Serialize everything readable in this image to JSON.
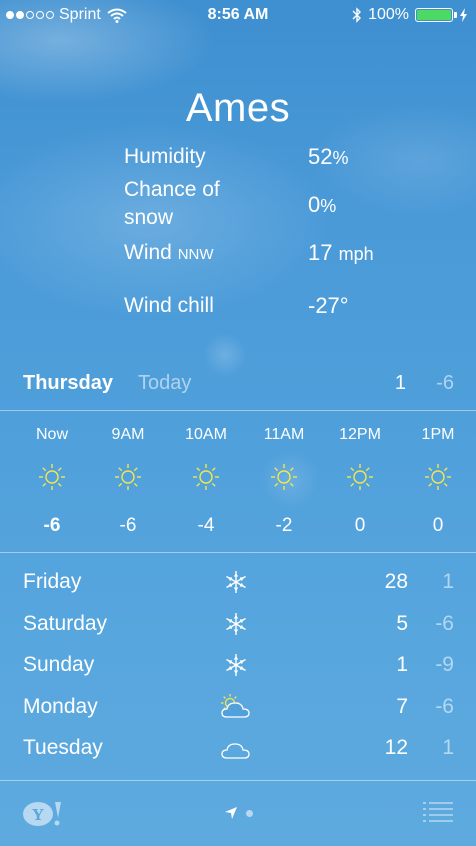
{
  "status": {
    "carrier": "Sprint",
    "time": "8:56 AM",
    "battery": "100%",
    "signal_bars": 2,
    "signal_total": 5
  },
  "city": "Ames",
  "details": {
    "humidity_label": "Humidity",
    "humidity_value": "52",
    "humidity_unit": "%",
    "snow_label_line1": "Chance of",
    "snow_label_line2": "snow",
    "snow_value": "0",
    "snow_unit": "%",
    "wind_label": "Wind",
    "wind_dir": "NNW",
    "wind_value": "17",
    "wind_unit": "mph",
    "chill_label": "Wind chill",
    "chill_value": "-27°"
  },
  "today": {
    "day": "Thursday",
    "label": "Today",
    "high": "1",
    "low": "-6"
  },
  "hourly": [
    {
      "label": "Now",
      "temp": "-6",
      "icon": "sun-icon"
    },
    {
      "label": "9AM",
      "temp": "-6",
      "icon": "sun-icon"
    },
    {
      "label": "10AM",
      "temp": "-4",
      "icon": "sun-icon"
    },
    {
      "label": "11AM",
      "temp": "-2",
      "icon": "sun-icon"
    },
    {
      "label": "12PM",
      "temp": "0",
      "icon": "sun-icon"
    },
    {
      "label": "1PM",
      "temp": "0",
      "icon": "sun-icon"
    }
  ],
  "daily": [
    {
      "day": "Friday",
      "icon": "snowflake-icon",
      "high": "28",
      "low": "1"
    },
    {
      "day": "Saturday",
      "icon": "snowflake-icon",
      "high": "5",
      "low": "-6"
    },
    {
      "day": "Sunday",
      "icon": "snowflake-icon",
      "high": "1",
      "low": "-9"
    },
    {
      "day": "Monday",
      "icon": "partly-cloudy-icon",
      "high": "7",
      "low": "-6"
    },
    {
      "day": "Tuesday",
      "icon": "cloud-icon",
      "high": "12",
      "low": "1"
    }
  ],
  "colors": {
    "sun": "#f7e64a",
    "battery": "#4cd964",
    "sky": "#4f9fdb"
  }
}
